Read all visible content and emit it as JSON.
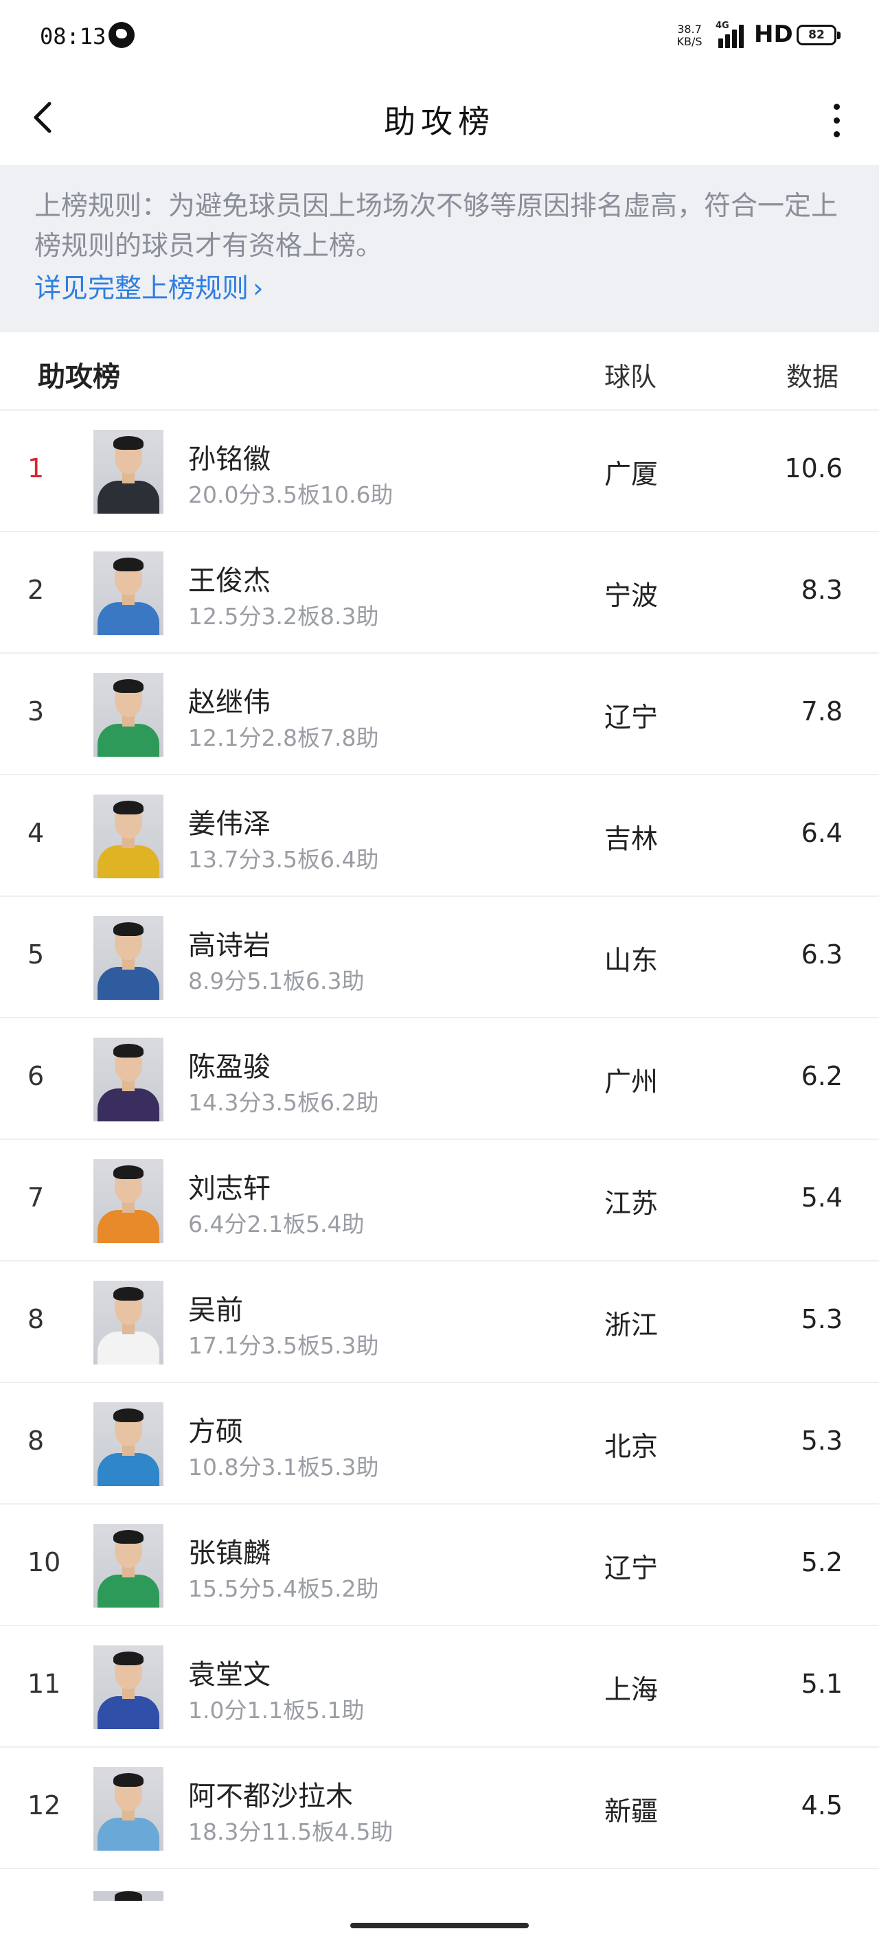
{
  "status_bar": {
    "time": "08:13",
    "net_speed_value": "38.7",
    "net_speed_unit": "KB/S",
    "network_type": "4G",
    "hd_label": "HD",
    "battery": "82"
  },
  "header": {
    "title": "助攻榜"
  },
  "notice": {
    "text": "上榜规则：为避免球员因上场场次不够等原因排名虚高，符合一定上榜规则的球员才有资格上榜。",
    "link_label": "详见完整上榜规则",
    "link_chevron": "›"
  },
  "table": {
    "title": "助攻榜",
    "team_header": "球队",
    "data_header": "数据",
    "rows": [
      {
        "rank": "1",
        "name": "孙铭徽",
        "stats": "20.0分3.5板10.6助",
        "team": "广厦",
        "value": "10.6",
        "jersey_color": "#2b2f36"
      },
      {
        "rank": "2",
        "name": "王俊杰",
        "stats": "12.5分3.2板8.3助",
        "team": "宁波",
        "value": "8.3",
        "jersey_color": "#3b78c4"
      },
      {
        "rank": "3",
        "name": "赵继伟",
        "stats": "12.1分2.8板7.8助",
        "team": "辽宁",
        "value": "7.8",
        "jersey_color": "#2e9a5a"
      },
      {
        "rank": "4",
        "name": "姜伟泽",
        "stats": "13.7分3.5板6.4助",
        "team": "吉林",
        "value": "6.4",
        "jersey_color": "#e0b325"
      },
      {
        "rank": "5",
        "name": "高诗岩",
        "stats": "8.9分5.1板6.3助",
        "team": "山东",
        "value": "6.3",
        "jersey_color": "#2f5c9e"
      },
      {
        "rank": "6",
        "name": "陈盈骏",
        "stats": "14.3分3.5板6.2助",
        "team": "广州",
        "value": "6.2",
        "jersey_color": "#3a2e5e"
      },
      {
        "rank": "7",
        "name": "刘志轩",
        "stats": "6.4分2.1板5.4助",
        "team": "江苏",
        "value": "5.4",
        "jersey_color": "#e8892a"
      },
      {
        "rank": "8",
        "name": "吴前",
        "stats": "17.1分3.5板5.3助",
        "team": "浙江",
        "value": "5.3",
        "jersey_color": "#f3f3f3"
      },
      {
        "rank": "8",
        "name": "方硕",
        "stats": "10.8分3.1板5.3助",
        "team": "北京",
        "value": "5.3",
        "jersey_color": "#2f86c8"
      },
      {
        "rank": "10",
        "name": "张镇麟",
        "stats": "15.5分5.4板5.2助",
        "team": "辽宁",
        "value": "5.2",
        "jersey_color": "#2e9a5a"
      },
      {
        "rank": "11",
        "name": "袁堂文",
        "stats": "1.0分1.1板5.1助",
        "team": "上海",
        "value": "5.1",
        "jersey_color": "#2f4fa8"
      },
      {
        "rank": "12",
        "name": "阿不都沙拉木",
        "stats": "18.3分11.5板4.5助",
        "team": "新疆",
        "value": "4.5",
        "jersey_color": "#6aa8d8"
      }
    ]
  },
  "colors": {
    "accent_link": "#2f7fe0",
    "rank_first": "#d9252e",
    "notice_bg": "#eef0f4"
  },
  "icons": {
    "back": "back-arrow-icon",
    "more": "more-vertical-icon"
  }
}
